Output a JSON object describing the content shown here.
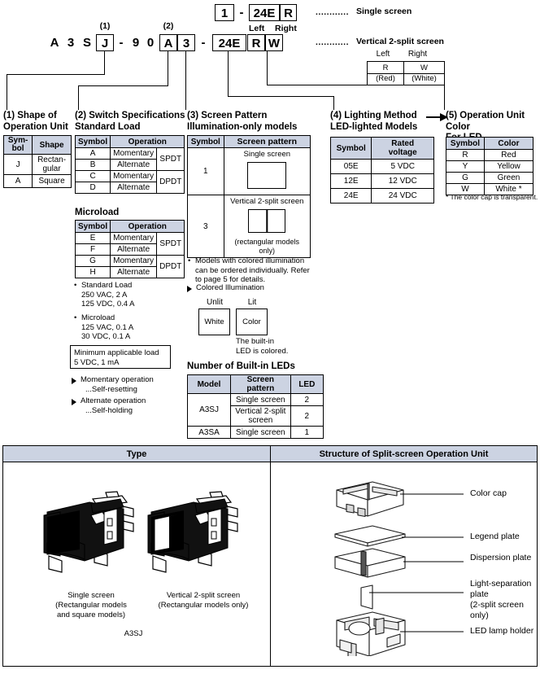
{
  "model_number": {
    "prefix_chars": [
      "A",
      "3",
      "S"
    ],
    "box1": "J",
    "dash1": "-",
    "mid_chars": [
      "9",
      "0"
    ],
    "box2a": "A",
    "box2b": "3",
    "dash2": "-",
    "box3": "24E",
    "box4a": "R",
    "box4b": "W",
    "marker1": "(1)",
    "marker2": "(2)",
    "single_line": {
      "box_num": "1",
      "dash": "-",
      "volt": "24E",
      "color": "R"
    },
    "left_right_label_left": "Left",
    "left_right_label_right": "Right",
    "callout_single": "Single screen",
    "callout_split": "Vertical 2-split screen",
    "dots": "............",
    "lr_table": {
      "headers": [
        "Left",
        "Right"
      ],
      "row": [
        "R\n(Red)",
        "W\n(White)"
      ],
      "left_sym": "R",
      "left_name": "(Red)",
      "right_sym": "W",
      "right_name": "(White)"
    }
  },
  "col1": {
    "heading_line1": "(1) Shape of",
    "heading_line2": "Operation Unit",
    "table": {
      "headers": [
        "Sym-\nbol",
        "Shape"
      ],
      "header_sym_l1": "Sym-",
      "header_sym_l2": "bol",
      "header_shape": "Shape",
      "rows": [
        {
          "symbol": "J",
          "shape_l1": "Rectan-",
          "shape_l2": "gular"
        },
        {
          "symbol": "A",
          "shape_l1": "Square",
          "shape_l2": ""
        }
      ]
    }
  },
  "col2": {
    "heading_line1": "(2) Switch Specifications",
    "heading_line2": "Standard Load",
    "standard_table": {
      "header_symbol": "Symbol",
      "header_operation": "Operation",
      "rows": [
        {
          "symbol": "A",
          "operation": "Momentary",
          "pole": "SPDT"
        },
        {
          "symbol": "B",
          "operation": "Alternate",
          "pole": ""
        },
        {
          "symbol": "C",
          "operation": "Momentary",
          "pole": "DPDT"
        },
        {
          "symbol": "D",
          "operation": "Alternate",
          "pole": ""
        }
      ]
    },
    "microload_heading": "Microload",
    "microload_table": {
      "header_symbol": "Symbol",
      "header_operation": "Operation",
      "rows": [
        {
          "symbol": "E",
          "operation": "Momentary",
          "pole": "SPDT"
        },
        {
          "symbol": "F",
          "operation": "Alternate",
          "pole": ""
        },
        {
          "symbol": "G",
          "operation": "Momentary",
          "pole": "DPDT"
        },
        {
          "symbol": "H",
          "operation": "Alternate",
          "pole": ""
        }
      ]
    },
    "note_standard_l1": "Standard Load",
    "note_standard_l2": "250 VAC, 2 A",
    "note_standard_l3": "125 VDC, 0.4 A",
    "note_micro_l1": "Microload",
    "note_micro_l2": "125 VAC, 0.1 A",
    "note_micro_l3": "30 VDC, 0.1 A",
    "minload_l1": "Minimum applicable load",
    "minload_l2": "5 VDC, 1 mA",
    "tri_momentary_l1": "Momentary operation",
    "tri_momentary_l2": "...Self-resetting",
    "tri_alternate_l1": "Alternate operation",
    "tri_alternate_l2": "...Self-holding"
  },
  "col3": {
    "heading_line1": "(3) Screen Pattern",
    "heading_line2": "Illumination-only models",
    "table": {
      "header_symbol": "Symbol",
      "header_pattern": "Screen pattern",
      "rows": [
        {
          "symbol": "1",
          "caption_top": "Single screen",
          "caption_bottom": "",
          "split": false
        },
        {
          "symbol": "3",
          "caption_top": "Vertical 2-split screen",
          "caption_bottom": "(rectangular models only)",
          "split": true
        }
      ]
    },
    "note_l1": "Models with colored illumination",
    "note_l2": "can be ordered individually. Refer",
    "note_l3": "to page 5 for details.",
    "colored_illum_heading": "Colored Illumination",
    "unlit_label": "Unlit",
    "lit_label": "Lit",
    "unlit_box": "White",
    "lit_box": "Color",
    "builtin_l1": "The built-in",
    "builtin_l2": "LED is colored.",
    "leds_heading": "Number of Built-in LEDs",
    "leds_table": {
      "headers": [
        "Model",
        "Screen pattern",
        "LED"
      ],
      "rows": [
        {
          "model": "A3SJ",
          "pattern": "Single screen",
          "pattern_l2": "",
          "led": "2"
        },
        {
          "model": "",
          "pattern": "Vertical 2-split",
          "pattern_l2": "screen",
          "led": "2"
        },
        {
          "model": "A3SA",
          "pattern": "Single screen",
          "pattern_l2": "",
          "led": "1"
        }
      ]
    }
  },
  "col4": {
    "heading_line1": "(4) Lighting Method",
    "heading_line2": "LED-lighted Models",
    "table": {
      "header_symbol": "Symbol",
      "header_voltage_l1": "Rated",
      "header_voltage_l2": "voltage",
      "rows": [
        {
          "symbol": "05E",
          "voltage": "5 VDC"
        },
        {
          "symbol": "12E",
          "voltage": "12 VDC"
        },
        {
          "symbol": "24E",
          "voltage": "24 VDC"
        }
      ]
    }
  },
  "col5": {
    "heading_line1": "(5) Operation Unit Color",
    "heading_line2": "For LED",
    "table": {
      "header_symbol": "Symbol",
      "header_color": "Color",
      "rows": [
        {
          "symbol": "R",
          "color": "Red"
        },
        {
          "symbol": "Y",
          "color": "Yellow"
        },
        {
          "symbol": "G",
          "color": "Green"
        },
        {
          "symbol": "W",
          "color": "White *"
        }
      ]
    },
    "footnote": "* The color cap is transparent."
  },
  "bottom": {
    "type_header": "Type",
    "structure_header": "Structure of Split-screen Operation Unit",
    "type_items": [
      {
        "caption_l1": "Single screen",
        "caption_l2": "(Rectangular models",
        "caption_l3": "and square models)"
      },
      {
        "caption_l1": "Vertical 2-split screen",
        "caption_l2": "(Rectangular models only)",
        "caption_l3": ""
      }
    ],
    "type_model_label": "A3SJ",
    "structure_labels": [
      {
        "text": "Color cap",
        "text_l2": ""
      },
      {
        "text": "Legend plate",
        "text_l2": ""
      },
      {
        "text": "Dispersion plate",
        "text_l2": ""
      },
      {
        "text": "Light-separation plate",
        "text_l2": "(2-split screen only)"
      },
      {
        "text": "LED lamp holder",
        "text_l2": ""
      }
    ]
  },
  "colors": {
    "table_header_bg": "#ccd3e2",
    "line": "#000000",
    "page_bg": "#ffffff"
  }
}
